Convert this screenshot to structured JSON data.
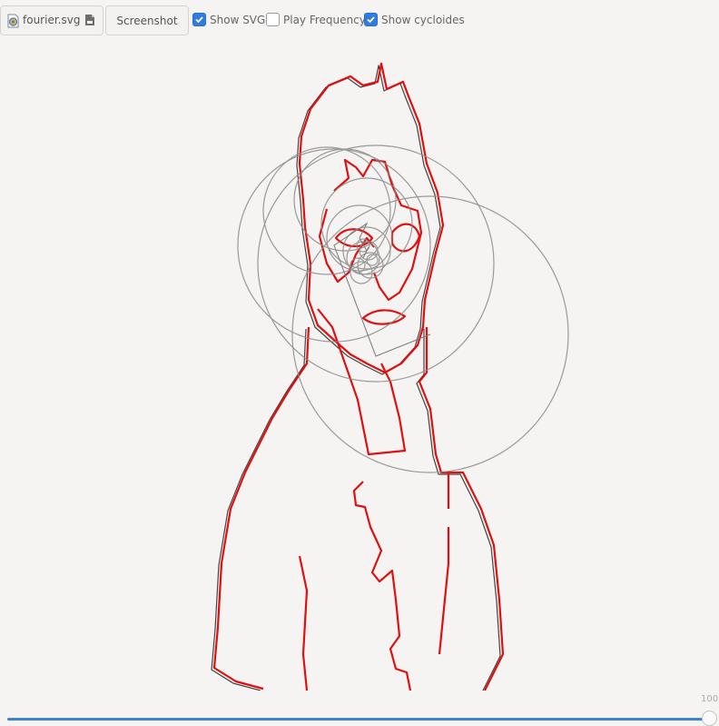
{
  "toolbar": {
    "file": {
      "name": "fourier.svg",
      "file_icon": "svg-file-icon",
      "open_icon": "open-file-icon"
    },
    "screenshot_label": "Screenshot",
    "checkboxes": [
      {
        "label": "Show SVG",
        "checked": true
      },
      {
        "label": "Play Frequency",
        "checked": false
      },
      {
        "label": "Show cycloides",
        "checked": true
      }
    ]
  },
  "slider": {
    "value": "100",
    "fraction": 1.0
  },
  "colors": {
    "trace": "#e01010",
    "svg_outline": "#444444",
    "cycloid": "#8a8a8a",
    "accent": "#2f7de1"
  }
}
